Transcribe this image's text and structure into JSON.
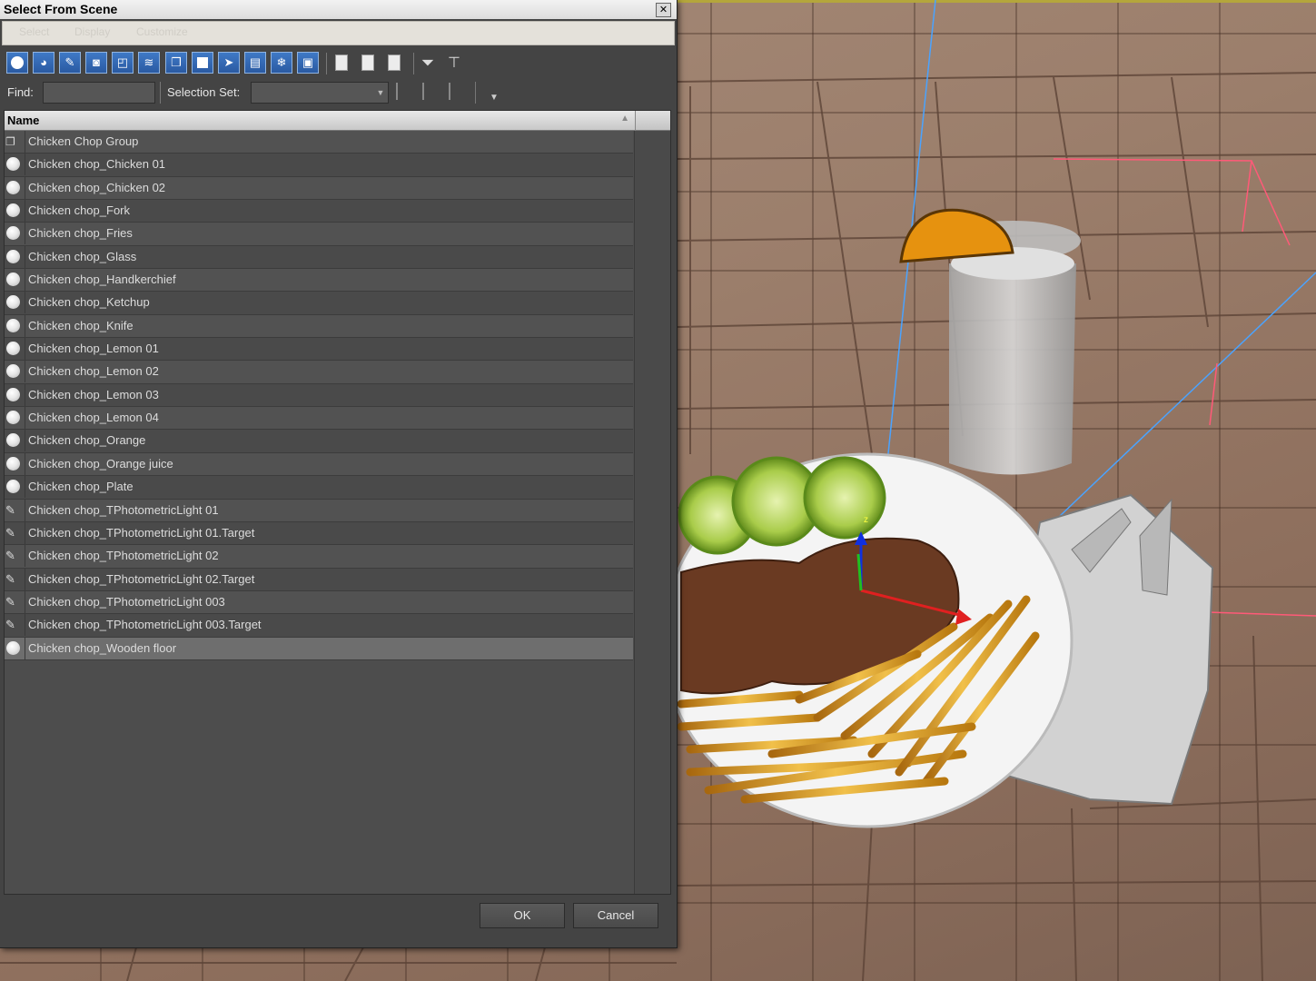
{
  "dialog": {
    "title": "Select From Scene",
    "close_glyph": "✕",
    "menu": [
      "Select",
      "Display",
      "Customize"
    ],
    "find_label": "Find:",
    "find_value": "",
    "selection_set_label": "Selection Set:",
    "selection_set_value": "",
    "column_header": "Name",
    "sort_indicator": "▲",
    "items": [
      {
        "label": "Chicken Chop Group",
        "icon": "group-icon",
        "selected": false
      },
      {
        "label": "Chicken chop_Chicken 01",
        "icon": "geometry-sphere-icon",
        "selected": false
      },
      {
        "label": "Chicken chop_Chicken 02",
        "icon": "geometry-sphere-icon",
        "selected": false
      },
      {
        "label": "Chicken chop_Fork",
        "icon": "geometry-sphere-icon",
        "selected": false
      },
      {
        "label": "Chicken chop_Fries",
        "icon": "geometry-sphere-icon",
        "selected": false
      },
      {
        "label": "Chicken chop_Glass",
        "icon": "geometry-sphere-icon",
        "selected": false
      },
      {
        "label": "Chicken chop_Handkerchief",
        "icon": "geometry-sphere-icon",
        "selected": false
      },
      {
        "label": "Chicken chop_Ketchup",
        "icon": "geometry-sphere-icon",
        "selected": false
      },
      {
        "label": "Chicken chop_Knife",
        "icon": "geometry-sphere-icon",
        "selected": false
      },
      {
        "label": "Chicken chop_Lemon 01",
        "icon": "geometry-sphere-icon",
        "selected": false
      },
      {
        "label": "Chicken chop_Lemon 02",
        "icon": "geometry-sphere-icon",
        "selected": false
      },
      {
        "label": "Chicken chop_Lemon 03",
        "icon": "geometry-sphere-icon",
        "selected": false
      },
      {
        "label": "Chicken chop_Lemon 04",
        "icon": "geometry-sphere-icon",
        "selected": false
      },
      {
        "label": "Chicken chop_Orange",
        "icon": "geometry-sphere-icon",
        "selected": false
      },
      {
        "label": "Chicken chop_Orange juice",
        "icon": "geometry-sphere-icon",
        "selected": false
      },
      {
        "label": "Chicken chop_Plate",
        "icon": "geometry-sphere-icon",
        "selected": false
      },
      {
        "label": "Chicken chop_TPhotometricLight 01",
        "icon": "light-icon",
        "selected": false
      },
      {
        "label": "Chicken chop_TPhotometricLight 01.Target",
        "icon": "light-icon",
        "selected": false
      },
      {
        "label": "Chicken chop_TPhotometricLight 02",
        "icon": "light-icon",
        "selected": false
      },
      {
        "label": "Chicken chop_TPhotometricLight 02.Target",
        "icon": "light-icon",
        "selected": false
      },
      {
        "label": "Chicken chop_TPhotometricLight 003",
        "icon": "light-icon",
        "selected": false
      },
      {
        "label": "Chicken chop_TPhotometricLight 003.Target",
        "icon": "light-icon",
        "selected": false
      },
      {
        "label": "Chicken chop_Wooden floor",
        "icon": "geometry-sphere-icon",
        "selected": true
      }
    ],
    "ok_label": "OK",
    "cancel_label": "Cancel"
  },
  "toolbar": {
    "filter_buttons": [
      "display-geometry-icon",
      "display-shapes-icon",
      "display-lights-icon",
      "display-cameras-icon",
      "display-helpers-icon",
      "display-spacewarps-icon",
      "display-groups-icon",
      "display-xrefs-icon",
      "display-bones-icon",
      "display-containers-icon",
      "display-frozen-icon",
      "display-hidden-icon"
    ],
    "select_buttons": [
      "select-all-icon",
      "select-none-icon",
      "select-invert-icon"
    ],
    "filter_icons": [
      "filter-icon",
      "filter-options-icon"
    ]
  },
  "viewport": {
    "floor_color": "#9c7f6c",
    "axis_colors": {
      "x": "#e02020",
      "y": "#20c020",
      "z": "#1030e0"
    },
    "axis_labels": {
      "z": "z"
    }
  }
}
